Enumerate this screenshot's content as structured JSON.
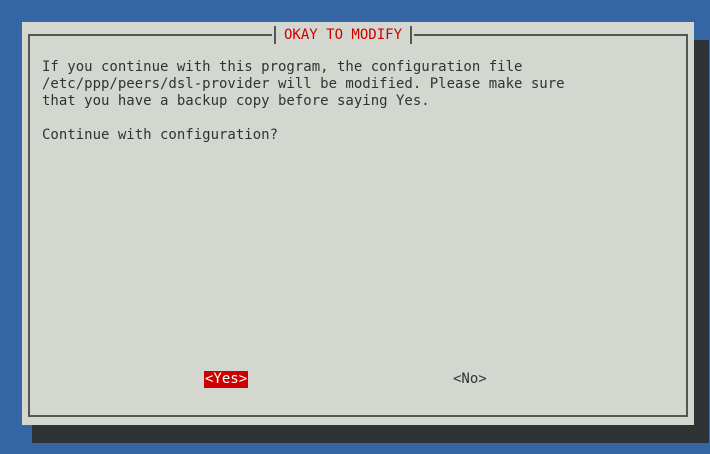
{
  "dialog": {
    "title": "OKAY TO MODIFY",
    "message_lines": [
      "If you continue with this program, the configuration file",
      "/etc/ppp/peers/dsl-provider will be modified. Please make sure",
      "that you have a backup copy before saying Yes."
    ],
    "question": "Continue with configuration?",
    "buttons": {
      "yes": "<Yes>",
      "no": "<No>"
    },
    "selected_button": "yes"
  },
  "colors": {
    "background": "#3465a4",
    "dialog": "#d3d7cf",
    "shadow": "#2e3436",
    "accent": "#cc0000",
    "text": "#2e3436",
    "border": "#555753"
  }
}
